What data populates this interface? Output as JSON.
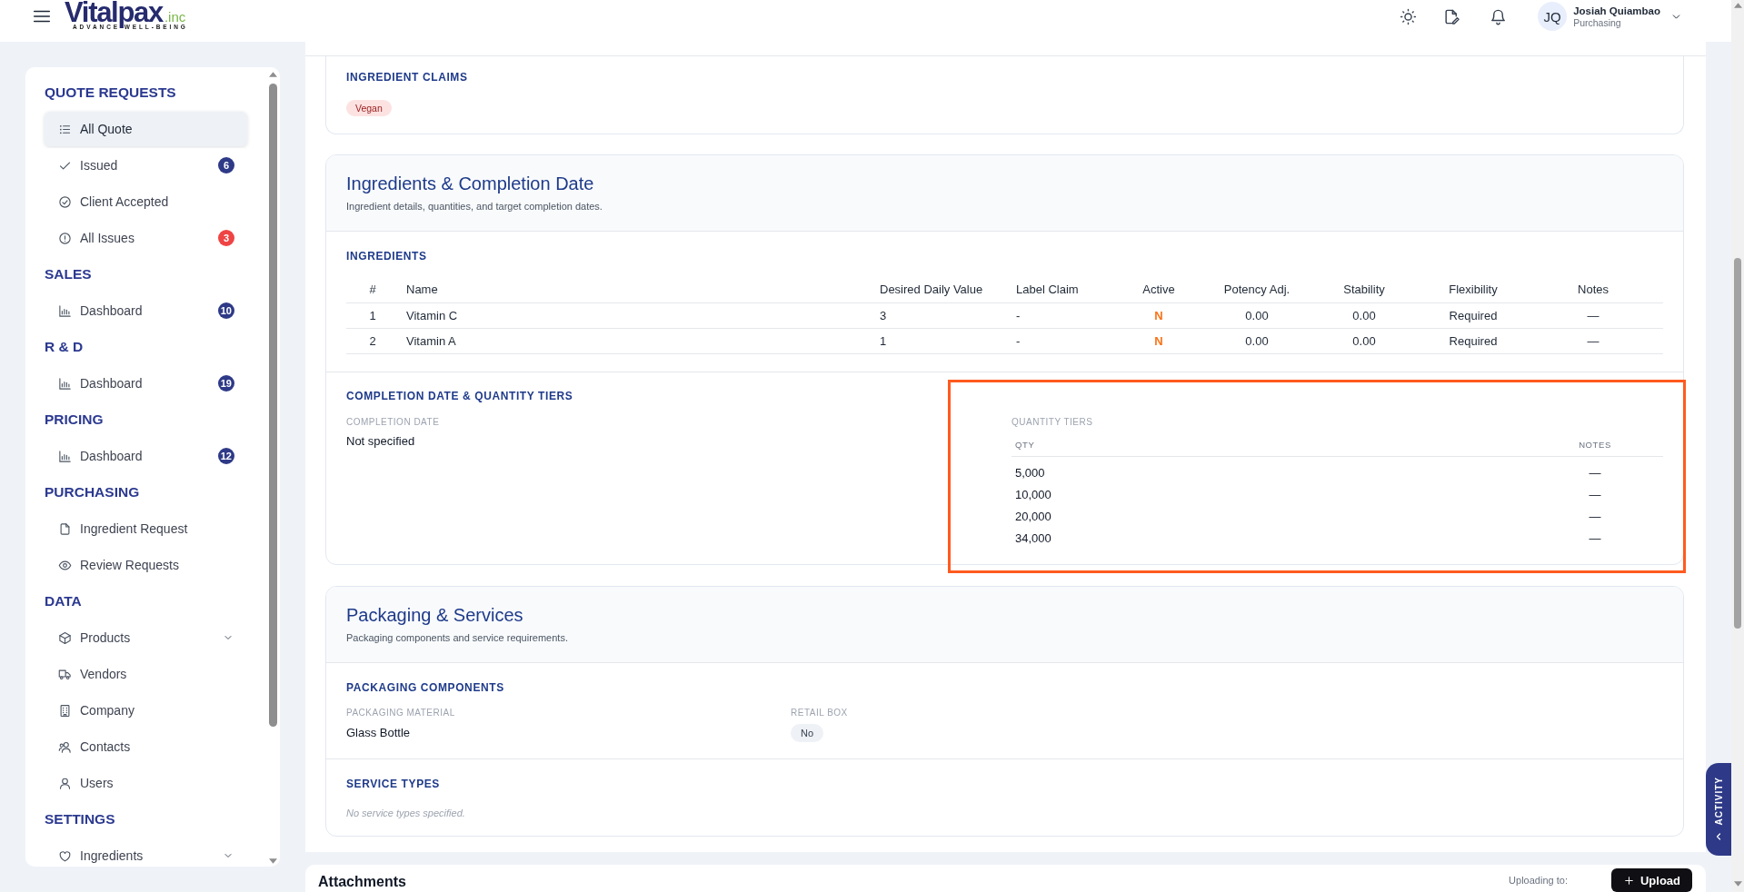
{
  "header": {
    "logo": {
      "name": "Vitalpax",
      "suffix": ".inc",
      "tagline": "ADVANCE WELL-BEING"
    },
    "user": {
      "initials": "JQ",
      "name": "Josiah Quiambao",
      "role": "Purchasing"
    }
  },
  "sidebar": {
    "sections": [
      {
        "title": "QUOTE REQUESTS",
        "items": [
          {
            "label": "All Quote",
            "selected": true,
            "submenu": false
          },
          {
            "label": "Issued",
            "selected": false,
            "submenu": false,
            "badge": {
              "text": "6",
              "color": "#2e3a87"
            }
          },
          {
            "label": "Client Accepted",
            "selected": false,
            "submenu": false
          },
          {
            "label": "All Issues",
            "selected": false,
            "submenu": false,
            "badge": {
              "text": "3",
              "color": "#ef4444"
            }
          }
        ]
      },
      {
        "title": "SALES",
        "items": [
          {
            "label": "Dashboard",
            "selected": false,
            "submenu": false,
            "badge": {
              "text": "10",
              "color": "#2e3a87"
            }
          }
        ]
      },
      {
        "title": "R & D",
        "items": [
          {
            "label": "Dashboard",
            "selected": false,
            "submenu": false,
            "badge": {
              "text": "19",
              "color": "#2e3a87"
            }
          }
        ]
      },
      {
        "title": "PRICING",
        "items": [
          {
            "label": "Dashboard",
            "selected": false,
            "submenu": false,
            "badge": {
              "text": "12",
              "color": "#2e3a87"
            }
          }
        ]
      },
      {
        "title": "PURCHASING",
        "items": [
          {
            "label": "Ingredient Request",
            "selected": false,
            "submenu": false
          },
          {
            "label": "Review Requests",
            "selected": false,
            "submenu": false
          }
        ]
      },
      {
        "title": "DATA",
        "items": [
          {
            "label": "Products",
            "selected": false,
            "submenu": true
          },
          {
            "label": "Vendors",
            "selected": false,
            "submenu": false
          },
          {
            "label": "Company",
            "selected": false,
            "submenu": false
          },
          {
            "label": "Contacts",
            "selected": false,
            "submenu": false
          },
          {
            "label": "Users",
            "selected": false,
            "submenu": false
          }
        ]
      },
      {
        "title": "SETTINGS",
        "items": [
          {
            "label": "Ingredients",
            "selected": false,
            "submenu": true
          }
        ]
      }
    ]
  },
  "claims": {
    "title": "INGREDIENT CLAIMS",
    "tags": [
      "Vegan"
    ]
  },
  "ingredients_card": {
    "title": "Ingredients & Completion Date",
    "subtitle": "Ingredient details, quantities, and target completion dates.",
    "ingredients": {
      "title": "INGREDIENTS",
      "columns": [
        "#",
        "Name",
        "Desired Daily Value",
        "Label Claim",
        "Active",
        "Potency Adj.",
        "Stability",
        "Flexibility",
        "Notes"
      ],
      "rows": [
        [
          "1",
          "Vitamin C",
          "3",
          "-",
          "N",
          "0.00",
          "0.00",
          "Required",
          "—"
        ],
        [
          "2",
          "Vitamin A",
          "1",
          "-",
          "N",
          "0.00",
          "0.00",
          "Required",
          "—"
        ]
      ]
    },
    "completion": {
      "title": "COMPLETION DATE & QUANTITY TIERS",
      "date": {
        "label": "COMPLETION DATE",
        "value": "Not specified"
      },
      "tiers": {
        "label": "QUANTITY TIERS",
        "highlighted": true,
        "columns": [
          "QTY",
          "NOTES"
        ],
        "rows": [
          [
            "5,000",
            "—"
          ],
          [
            "10,000",
            "—"
          ],
          [
            "20,000",
            "—"
          ],
          [
            "34,000",
            "—"
          ]
        ]
      }
    }
  },
  "packaging_card": {
    "title": "Packaging & Services",
    "subtitle": "Packaging components and service requirements.",
    "components": {
      "title": "PACKAGING COMPONENTS",
      "fields": [
        {
          "label": "PACKAGING MATERIAL",
          "value": "Glass Bottle",
          "kind": "text"
        },
        {
          "label": "RETAIL BOX",
          "value": "No",
          "kind": "chip"
        }
      ]
    },
    "services": {
      "title": "SERVICE TYPES",
      "empty_text": "No service types specified."
    }
  },
  "attachments": {
    "title": "Attachments",
    "upload_note": "Uploading to:",
    "button": "Upload"
  },
  "activity_tab": {
    "label": "ACTIVITY"
  }
}
